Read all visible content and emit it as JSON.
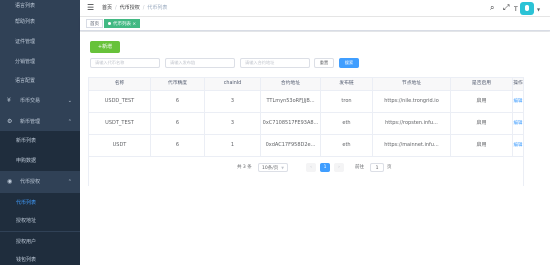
{
  "sidebar": {
    "items": [
      {
        "label": "语言列表",
        "kind": "plain"
      },
      {
        "label": "帮助列表",
        "kind": "plain"
      },
      {
        "label": "证件管理",
        "kind": "plain"
      },
      {
        "label": "分销管理",
        "kind": "plain"
      },
      {
        "label": "语言配置",
        "kind": "plain"
      },
      {
        "label": "币币交易",
        "kind": "group",
        "icon": "chart-icon",
        "icon_glyph": "¥",
        "expanded": false
      },
      {
        "label": "新币管理",
        "kind": "group",
        "icon": "gear-icon",
        "icon_glyph": "⚙",
        "expanded": true
      },
      {
        "label": "新币列表",
        "kind": "sub"
      },
      {
        "label": "申购数据",
        "kind": "sub"
      },
      {
        "label": "代币授权",
        "kind": "group",
        "icon": "wallet-icon",
        "icon_glyph": "◉",
        "expanded": true
      },
      {
        "label": "代币列表",
        "kind": "sub",
        "active": true
      },
      {
        "label": "授权地址",
        "kind": "sub"
      },
      {
        "label": "授权用户",
        "kind": "sub"
      },
      {
        "label": "钱包列表",
        "kind": "sub"
      }
    ]
  },
  "navbar": {
    "hamburger_icon": "☰",
    "breadcrumb": [
      "首页",
      "代币授权",
      "代币列表"
    ],
    "search_icon": "⌕",
    "fullscreen_icon": "⤢",
    "font_size_icon": "T",
    "avatar_caret": "▼"
  },
  "tags": [
    {
      "label": "首页",
      "active": false
    },
    {
      "label": "代币列表 ×",
      "active": true
    }
  ],
  "toolbar": {
    "add_label": "+新增",
    "placeholders": [
      "请输入代币名称",
      "请输入发布链",
      "请输入合约地址"
    ],
    "reset_label": "重置",
    "search_label": "搜索"
  },
  "table": {
    "headers": [
      "名称",
      "代币精度",
      "chainId",
      "合约地址",
      "发布链",
      "节点地址",
      "是否启用",
      "操作"
    ],
    "rows": [
      [
        "USDD_TEST",
        "6",
        "3",
        "TTLmyn53oRFJJjB...",
        "tron",
        "https://nile.trongrid.io",
        "启用",
        "编辑"
      ],
      [
        "USDT_TEST",
        "6",
        "3",
        "0xC7108517FE93A8...",
        "eth",
        "https://ropsten.infu...",
        "启用",
        "编辑"
      ],
      [
        "USDT",
        "6",
        "1",
        "0xdAC17F958D2e...",
        "eth",
        "https://mainnet.infu...",
        "启用",
        "编辑"
      ]
    ]
  },
  "pagination": {
    "total": "共 3 条",
    "page_size": "10条/页",
    "prev": "‹",
    "current": "1",
    "next": "›",
    "goto_label": "前往",
    "goto_value": "1",
    "page_suffix": "页"
  },
  "colors": {
    "sidebar_bg": "#304156",
    "sidebar_sub_bg": "#1f2d3d",
    "active": "#409eff",
    "add_button": "#67c23a",
    "tag_active": "#42b983",
    "avatar": "#2bc3d6"
  }
}
